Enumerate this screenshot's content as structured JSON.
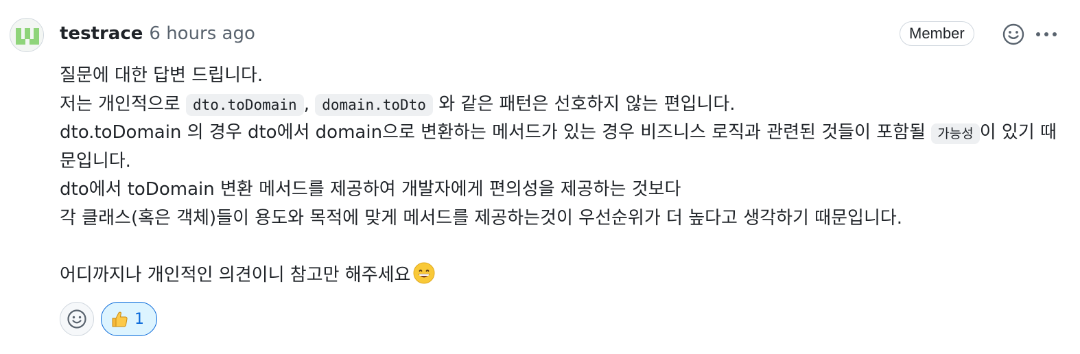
{
  "comment": {
    "author": "testrace",
    "time": "6 hours ago",
    "badge": "Member",
    "body": {
      "line1": "질문에 대한 답변 드립니다.",
      "line2": {
        "prefix": "저는 개인적으로 ",
        "code1": "dto.toDomain",
        "sep": ", ",
        "code2": "domain.toDto",
        "suffix": " 와 같은 패턴은 선호하지 않는 편입니다."
      },
      "line3": {
        "prefix": "dto.toDomain 의 경우 dto에서 domain으로 변환하는 메서드가 있는 경우 비즈니스 로직과 관련된 것들이 포함될 ",
        "code": "가능성",
        "suffix": "이 있기 때"
      },
      "line4": "문입니다.",
      "line5": "dto에서 toDomain 변환 메서드를 제공하여 개발자에게 편의성을 제공하는 것보다",
      "line6": "각 클래스(혹은 객체)들이 용도와 목적에 맞게 메서드를 제공하는것이 우선순위가 더 높다고 생각하기 때문입니다.",
      "line7": "어디까지나 개인적인 의견이니 참고만 해주세요"
    },
    "reactions": [
      {
        "icon": "thumbs-up-icon",
        "count": "1"
      }
    ]
  },
  "colors": {
    "text": "#1f2328",
    "muted": "#59636e",
    "border": "#d0d7de",
    "code_bg": "#eef0f2",
    "accent": "#0969da",
    "accent_bg": "#ddf4ff"
  }
}
